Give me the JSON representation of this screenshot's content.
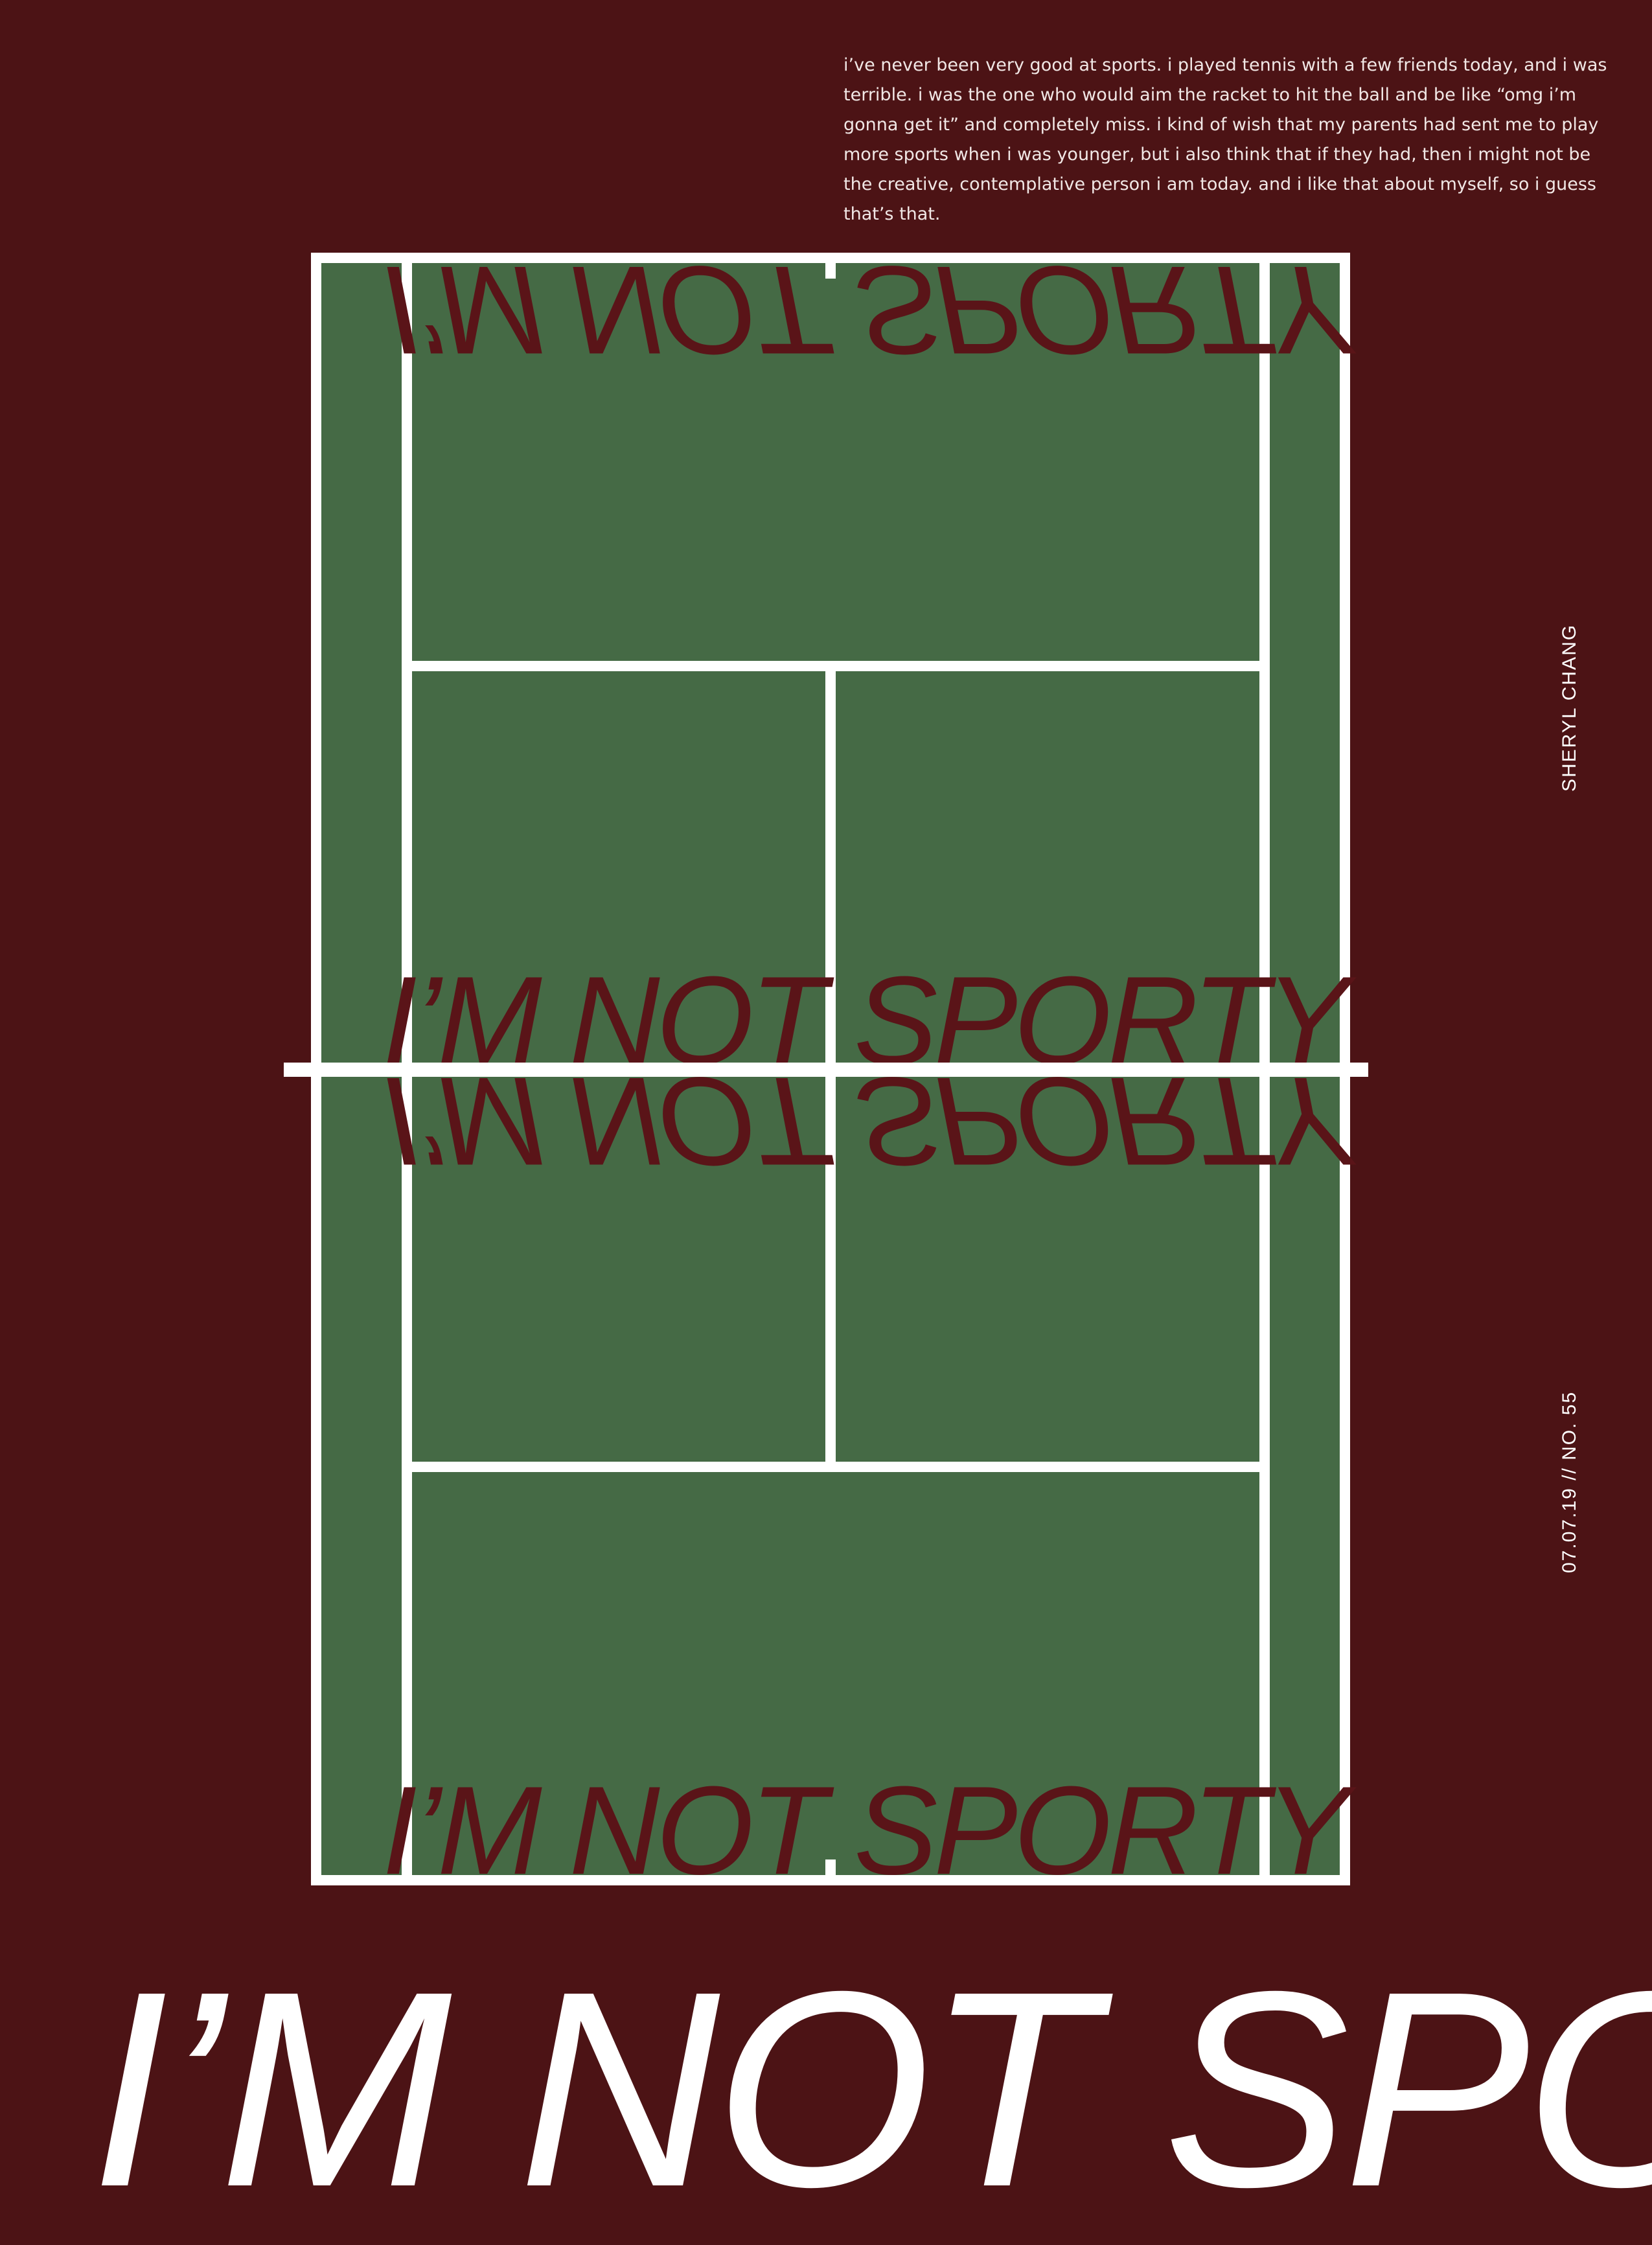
{
  "essay": {
    "text": "i’ve never been very good at sports. i played tennis with a few friends today, and i was terrible. i was the one who would aim the racket to hit the ball and be like “omg i’m gonna get it” and completely miss. i kind of wish that my parents had sent me to play more sports when i was younger, but i also think that if they had, then i might not be the creative, contemplative person i am today. and i like that about myself, so i guess that’s that."
  },
  "court": {
    "watermark": "I’M NOT SPORTY"
  },
  "side": {
    "author": "SHERYL CHANG",
    "issue": "07.07.19  //  NO. 55"
  },
  "headline": "I’M NOT SPORTY",
  "colors": {
    "background": "#4c1315",
    "court": "#456a45",
    "lines": "#ffffff",
    "watermark": "#5a1418"
  }
}
